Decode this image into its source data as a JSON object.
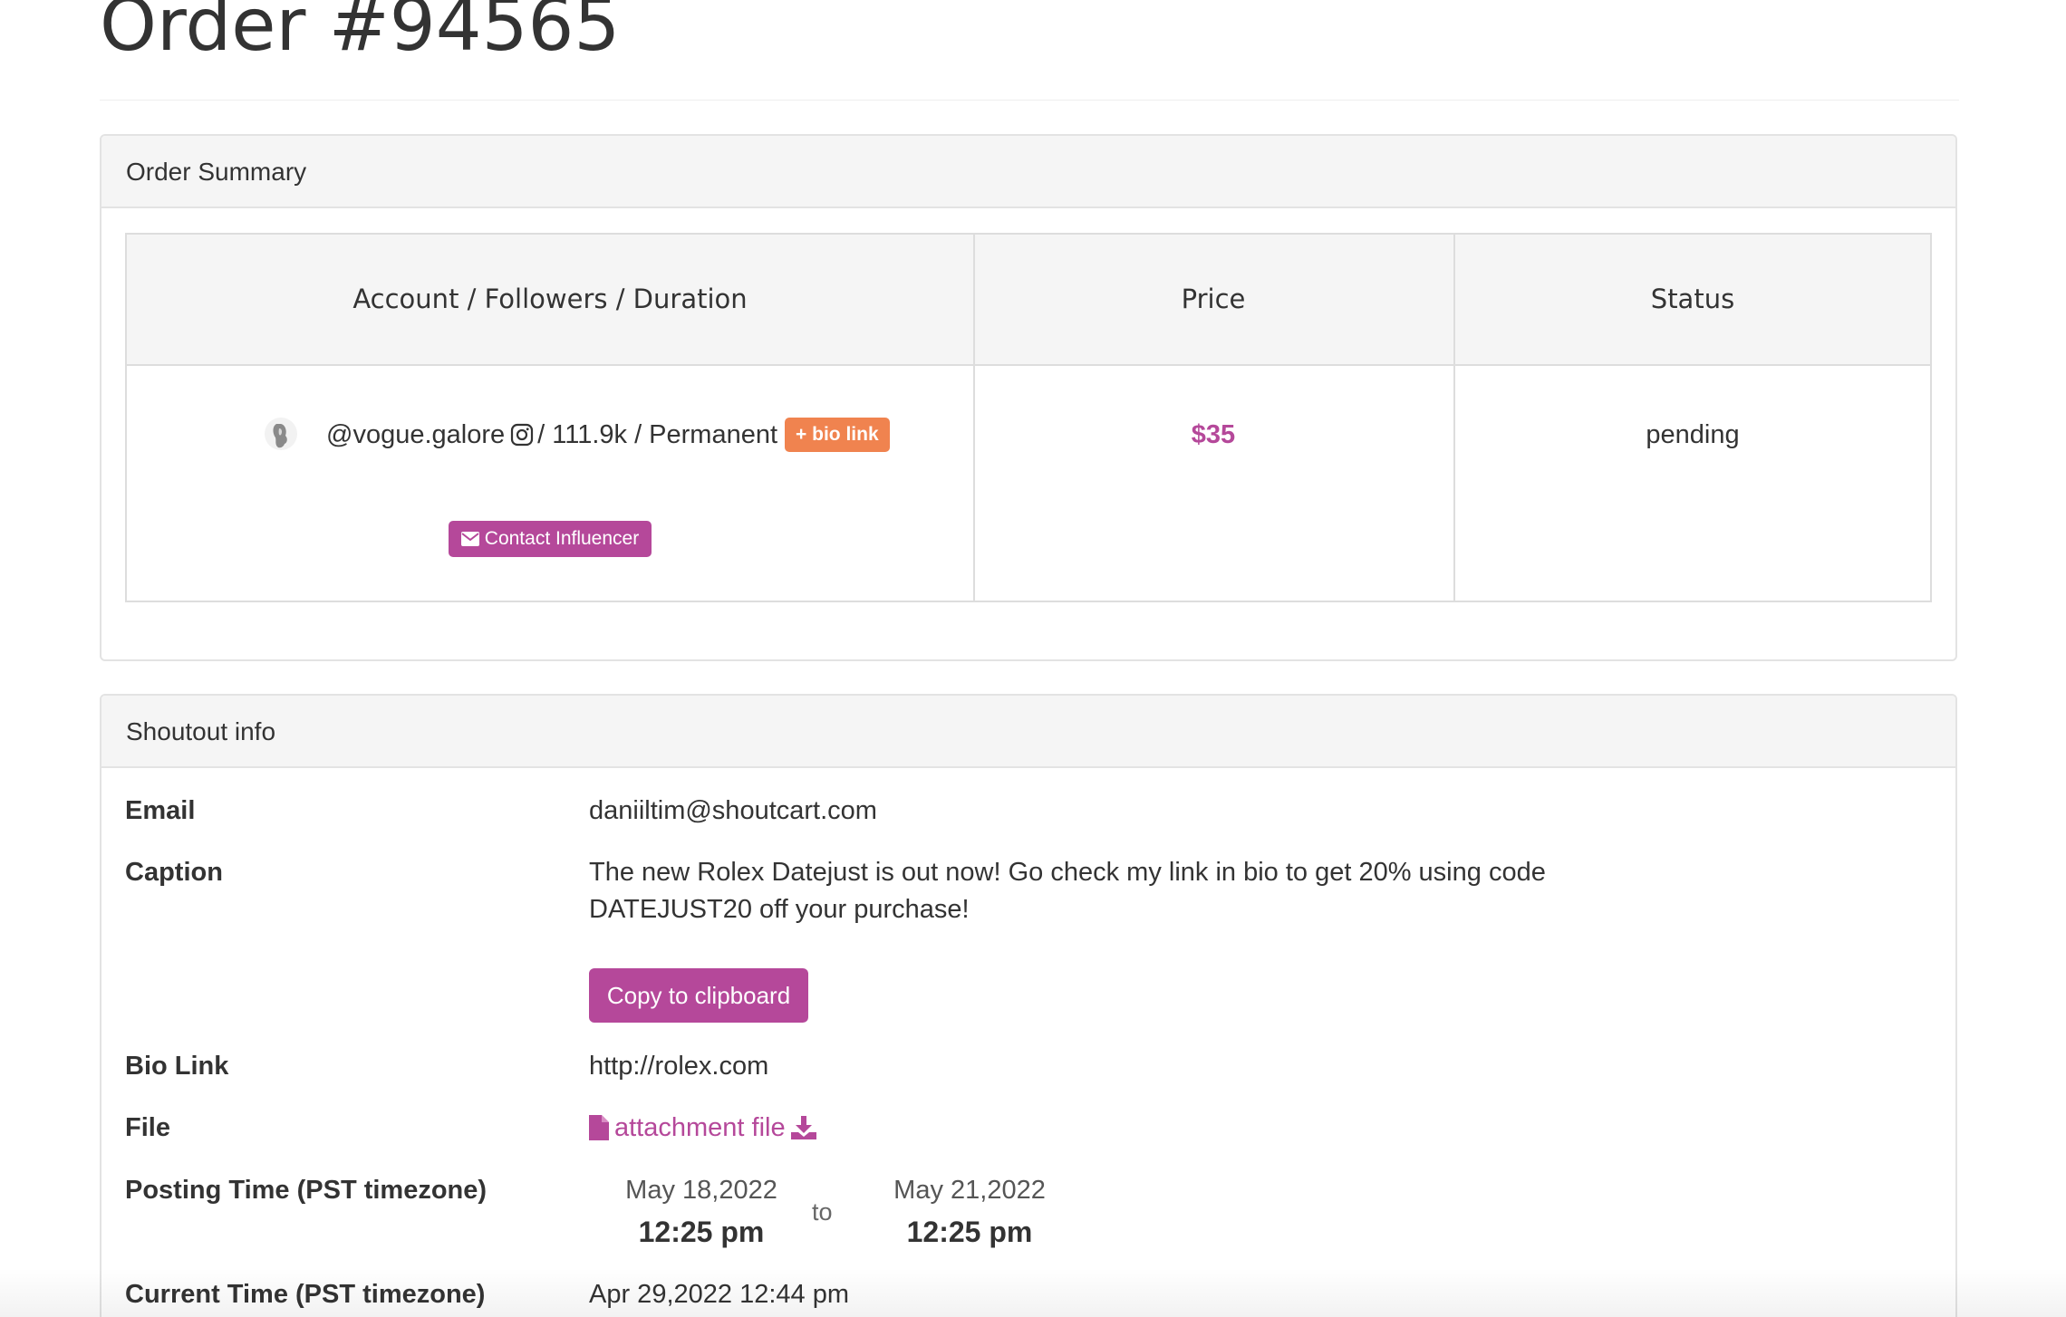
{
  "page": {
    "title": "Order #94565"
  },
  "summary": {
    "heading": "Order Summary",
    "columns": [
      "Account / Followers / Duration",
      "Price",
      "Status"
    ],
    "row": {
      "handle": "@vogue.galore",
      "followers_duration": "/ 111.9k / Permanent",
      "badge": "+ bio link",
      "contact_label": "Contact Influencer",
      "price": "$35",
      "status": "pending"
    }
  },
  "shoutout": {
    "heading": "Shoutout info",
    "fields": {
      "email_label": "Email",
      "email_value": "daniiltim@shoutcart.com",
      "caption_label": "Caption",
      "caption_value": "The new Rolex Datejust is out now! Go check my link in bio to get 20% using code DATEJUST20 off your purchase!",
      "copy_button": "Copy to clipboard",
      "bio_label": "Bio Link",
      "bio_value": "http://rolex.com",
      "file_label": "File",
      "file_link": "attachment file",
      "posting_label": "Posting Time (PST timezone)",
      "posting_start_date": "May 18,2022",
      "posting_start_time": "12:25 pm",
      "posting_to": "to",
      "posting_end_date": "May 21,2022",
      "posting_end_time": "12:25 pm",
      "current_label": "Current Time (PST timezone)",
      "current_value": "Apr 29,2022 12:44 pm"
    }
  },
  "colors": {
    "accent": "#b5489a",
    "badge": "#f0834f",
    "heading_bg": "#f5f5f5",
    "border": "#dddddd"
  },
  "icons": [
    "avatar-image",
    "instagram-icon",
    "envelope-icon",
    "file-icon",
    "download-icon"
  ]
}
